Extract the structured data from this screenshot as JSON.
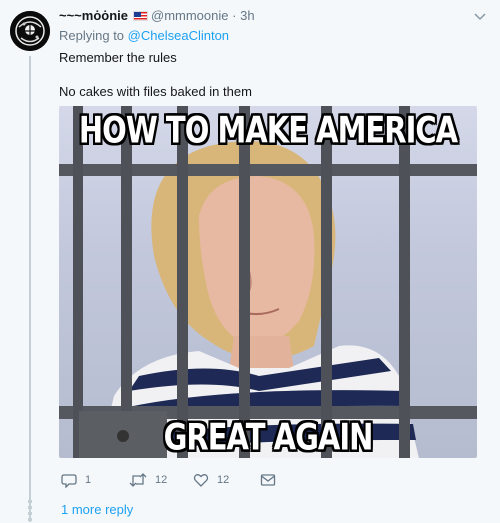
{
  "tweet": {
    "display_name": "~~~mȯȯnie",
    "handle": "@mmmoonie",
    "separator": "·",
    "time": "3h",
    "replying_prefix": "Replying to",
    "replying_to": "@ChelseaClinton",
    "line1": "Remember the rules",
    "line2": "No cakes with files baked in them"
  },
  "meme": {
    "top_caption": "HOW TO MAKE AMERICA",
    "bottom_caption": "GREAT AGAIN"
  },
  "actions": {
    "replies": "1",
    "retweets": "12",
    "likes": "12"
  },
  "more_replies": "1 more reply",
  "icons": [
    "reply-icon",
    "retweet-icon",
    "like-icon",
    "dm-icon",
    "chevron-down-icon",
    "us-flag-icon"
  ]
}
